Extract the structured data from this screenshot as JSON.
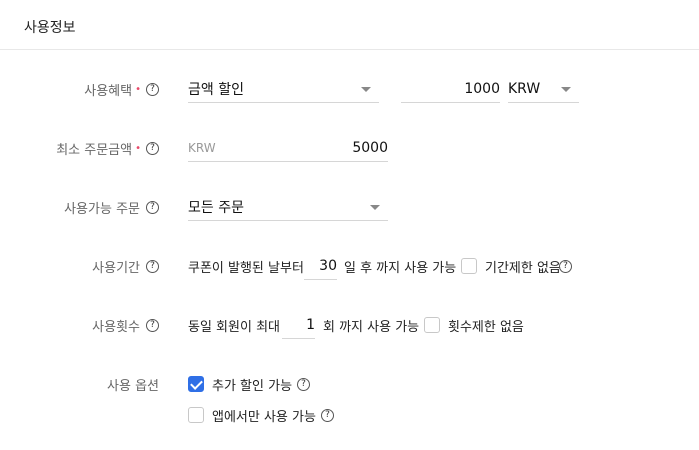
{
  "header": {
    "title": "사용정보"
  },
  "help_icon": "question-circle-icon",
  "accent_color": "#2f6fe6",
  "required_mark": "•",
  "benefit": {
    "label": "사용혜택",
    "type_value": "금액 할인",
    "amount": "1000",
    "currency": "KRW"
  },
  "min_order": {
    "label": "최소 주문금액",
    "currency_placeholder": "KRW",
    "amount": "5000"
  },
  "available_order": {
    "label": "사용가능 주문",
    "value": "모든 주문"
  },
  "period": {
    "label": "사용기간",
    "prefix": "쿠폰이 발행된 날부터",
    "days": "30",
    "suffix": "일 후 까지 사용 가능",
    "unlimited_label": "기간제한 없음",
    "unlimited_checked": false
  },
  "count": {
    "label": "사용횟수",
    "prefix": "동일 회원이 최대",
    "times": "1",
    "suffix": "회 까지 사용 가능",
    "unlimited_label": "횟수제한 없음",
    "unlimited_checked": false
  },
  "options": {
    "label": "사용 옵션",
    "items": [
      {
        "label": "추가 할인 가능",
        "checked": true
      },
      {
        "label": "앱에서만 사용 가능",
        "checked": false
      }
    ]
  }
}
